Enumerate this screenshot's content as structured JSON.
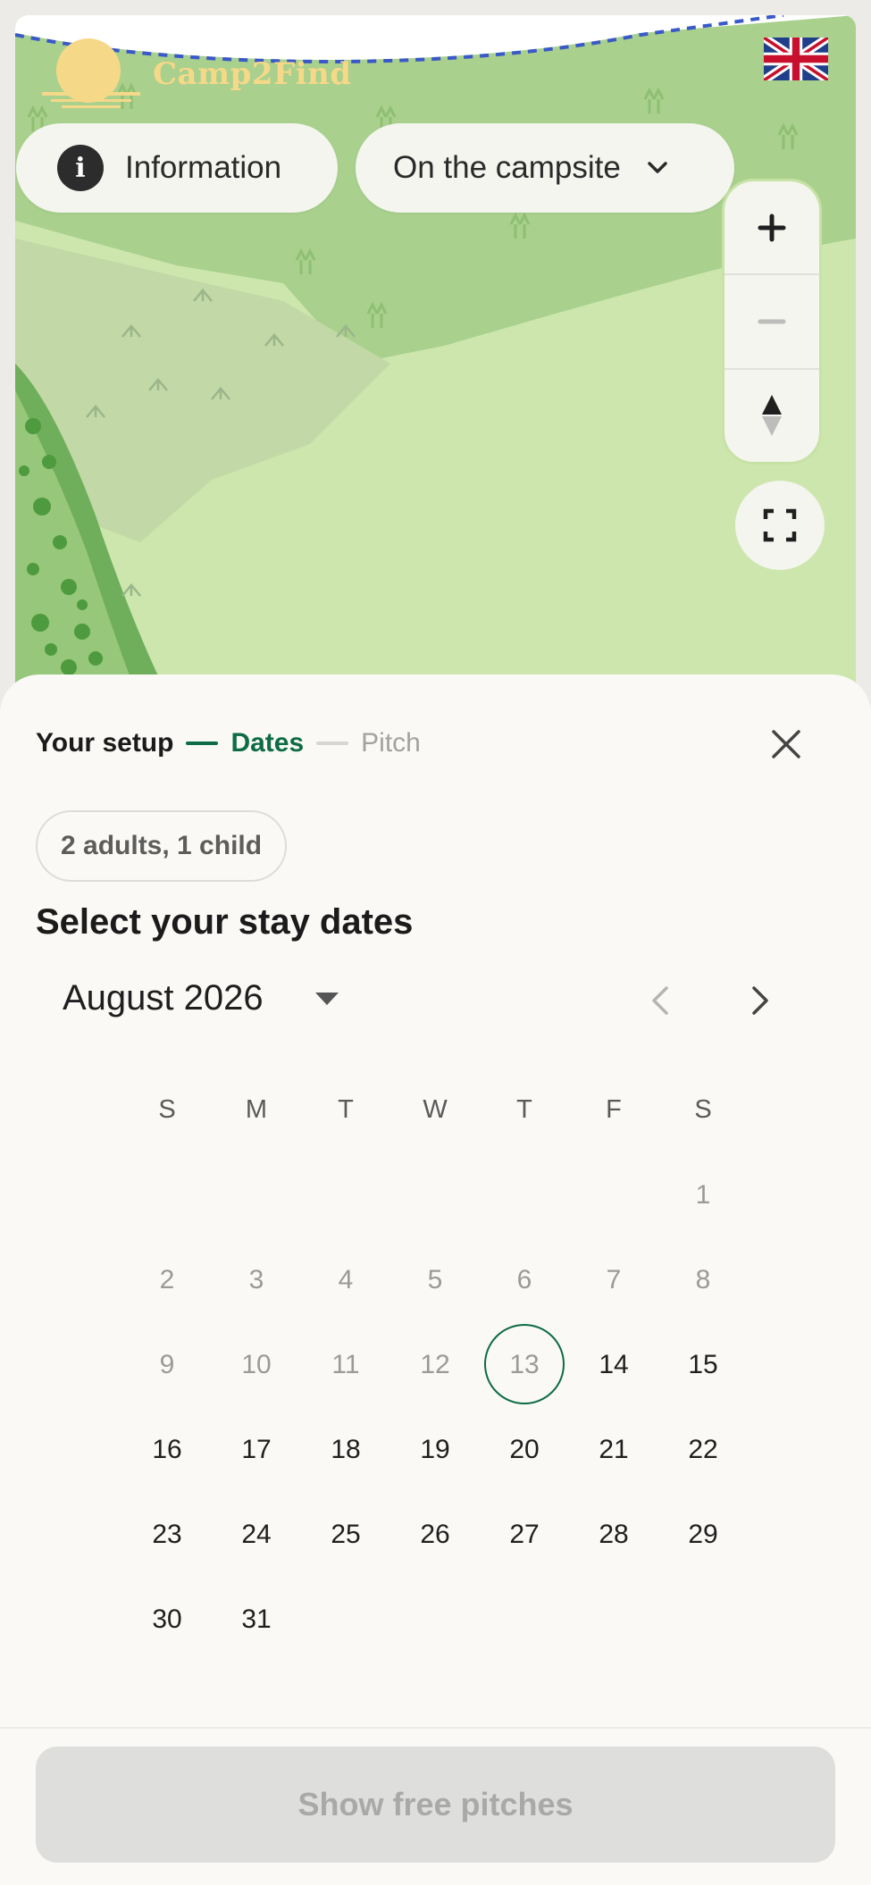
{
  "map": {
    "logo_text": "Camp2Find",
    "info_label": "Information",
    "info_icon": "info-icon",
    "campsite_label": "On the campsite",
    "language": "English (UK)"
  },
  "sheet": {
    "steps": [
      "Your setup",
      "Dates",
      "Pitch"
    ],
    "guests": "2 adults, 1 child",
    "heading": "Select your stay dates",
    "month": "August 2026",
    "weekdays": [
      "S",
      "M",
      "T",
      "W",
      "T",
      "F",
      "S"
    ],
    "weeks": [
      [
        "",
        "",
        "",
        "",
        "",
        "",
        "1"
      ],
      [
        "2",
        "3",
        "4",
        "5",
        "6",
        "7",
        "8"
      ],
      [
        "9",
        "10",
        "11",
        "12",
        "13",
        "14",
        "15"
      ],
      [
        "16",
        "17",
        "18",
        "19",
        "20",
        "21",
        "22"
      ],
      [
        "23",
        "24",
        "25",
        "26",
        "27",
        "28",
        "29"
      ],
      [
        "30",
        "31",
        "",
        "",
        "",
        "",
        ""
      ]
    ],
    "today": "13",
    "cta": "Show free pitches"
  },
  "colors": {
    "accent": "#0d6b45",
    "map_light": "#cfe5b0",
    "map_dark": "#a8cf8c",
    "logo": "#f6d889"
  }
}
